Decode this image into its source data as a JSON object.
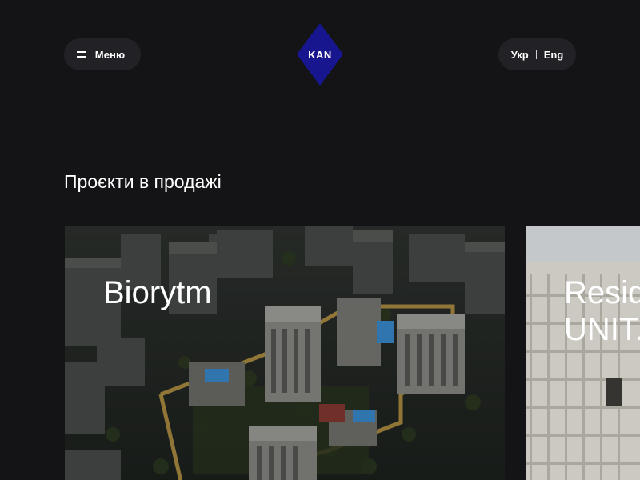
{
  "header": {
    "menu_label": "Меню",
    "logo_text": "KAN",
    "brand_color": "#17168f",
    "languages": [
      "Укр",
      "Eng"
    ]
  },
  "section": {
    "title": "Проєкти в продажі"
  },
  "projects": [
    {
      "title": "Biorytm"
    },
    {
      "title_line1": "Resid",
      "title_line2": "UNIT.H"
    }
  ],
  "icons": {
    "menu": "hamburger-icon",
    "logo": "diamond-logo"
  },
  "colors": {
    "background": "#141416",
    "pill": "#222226",
    "text": "#ffffff"
  }
}
